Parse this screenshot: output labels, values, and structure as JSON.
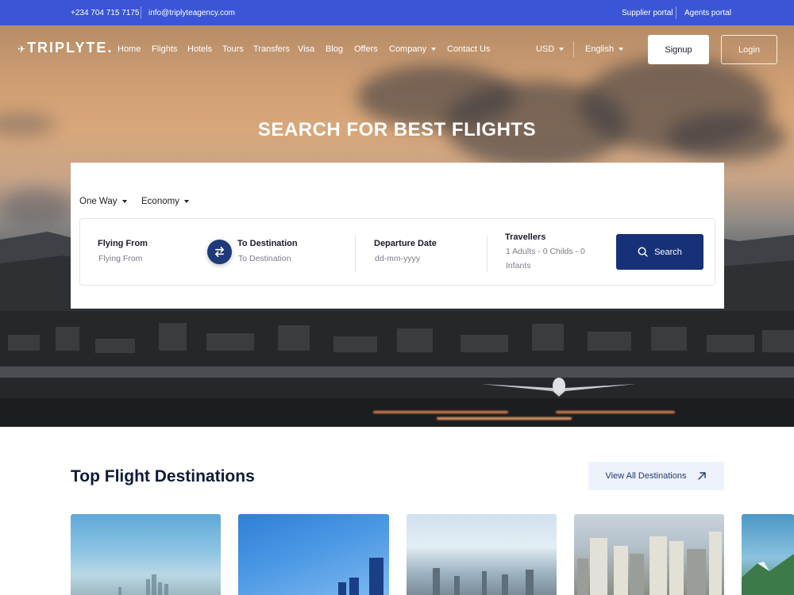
{
  "topbar": {
    "phone": "+234 704 715 7175",
    "email": "info@triplyteagency.com",
    "supplier_portal": "Supplier portal",
    "agents_portal": "Agents portal"
  },
  "header": {
    "logo": "TRIPLYTE.",
    "nav": [
      "Home",
      "Flights",
      "Hotels",
      "Tours",
      "Transfers",
      "Visa",
      "Blog",
      "Offers",
      "Company",
      "Contact Us"
    ],
    "currency": "USD",
    "language": "English",
    "signup": "Signup",
    "login": "Login"
  },
  "hero": {
    "title": "SEARCH FOR BEST FLIGHTS"
  },
  "search": {
    "trip_type": "One Way",
    "cabin_class": "Economy",
    "from_label": "Flying From",
    "from_placeholder": "Flying From",
    "to_label": "To Destination",
    "to_placeholder": "To Destination",
    "date_label": "Departure Date",
    "date_placeholder": "dd-mm-yyyy",
    "travellers_label": "Travellers",
    "travellers_value": "1 Adults - 0 Childs - 0 Infants",
    "search_button": "Search"
  },
  "destinations": {
    "title": "Top Flight Destinations",
    "view_all": "View All Destinations"
  },
  "colors": {
    "topbar": "#3a55d6",
    "primary": "#173178",
    "swap": "#1e3a78",
    "view_all_bg": "#eef2fb"
  },
  "icons": [
    "swap-icon",
    "search-icon",
    "arrow-up-right-icon",
    "caret-down-icon",
    "plane-logo-icon"
  ]
}
